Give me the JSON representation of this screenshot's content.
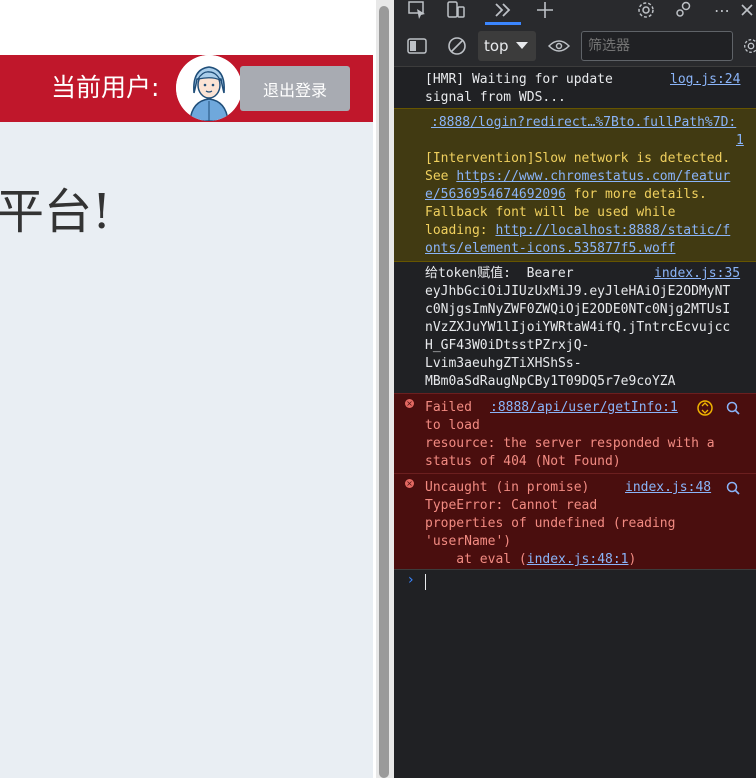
{
  "page": {
    "user_label": "当前用户:",
    "logout_label": "退出登录",
    "welcome_text": "平台!"
  },
  "devtools": {
    "tabs": {
      "icons": [
        "inspect-icon",
        "device-toolbar-icon",
        "more-tabs-icon",
        "new-tab-icon",
        "settings-icon",
        "feedback-icon",
        "more-options-icon"
      ]
    },
    "toolbar": {
      "context": "top",
      "filter_placeholder": "筛选器"
    },
    "messages": [
      {
        "type": "log",
        "text": "[HMR] Waiting for update\nsignal from WDS...",
        "source": "log.js:24"
      },
      {
        "type": "warning",
        "source_line1": ":8888/login?redirect…%7Bto.fullPath%7D:",
        "source_line2": "1",
        "text_1": "[Intervention]Slow network is detected.\nSee ",
        "link_1a": "https://www.chromestatus.com/featur",
        "link_1b": "e/5636954674692096",
        "text_2": " for more details.\nFallback font will be used while\nloading: ",
        "link_2a": "http://localhost:8888/static/f",
        "link_2b": "onts/element-icons.535877f5.woff"
      },
      {
        "type": "log",
        "text": "给token赋值:  Bearer\neyJhbGciOiJIUzUxMiJ9.eyJleHAiOjE2ODMyNT\nc0NjgsImNyZWF0ZWQiOjE2ODE0NTc0Njg2MTUsI\nnVzZXJuYW1lIjoiYWRtaW4ifQ.jTntrcEcvujcc\nH_GF43W0iDtsstPZrxjQ-\nLvim3aeuhgZTiXHShSs-\nMBm0aSdRaugNpCBy1T09DQ5r7e9coYZA",
        "source": "index.js:35"
      },
      {
        "type": "error",
        "text": "Failed\nto load\nresource: the server responded with a\nstatus of 404 (Not Found)",
        "source": ":8888/api/user/getInfo:1"
      },
      {
        "type": "error",
        "text": "Uncaught (in promise)\nTypeError: Cannot read\nproperties of undefined (reading\n'userName')\n    at eval (",
        "inline_link": "index.js:48:1",
        "text_end": ")",
        "source": "index.js:48"
      }
    ]
  },
  "colors": {
    "header_red": "#c0172b",
    "content_bg": "#e9eef3",
    "devtools_bg": "#202124",
    "warning_bg": "#413a12",
    "error_bg": "#4a0e0e",
    "link_blue": "#8ab4f8"
  }
}
